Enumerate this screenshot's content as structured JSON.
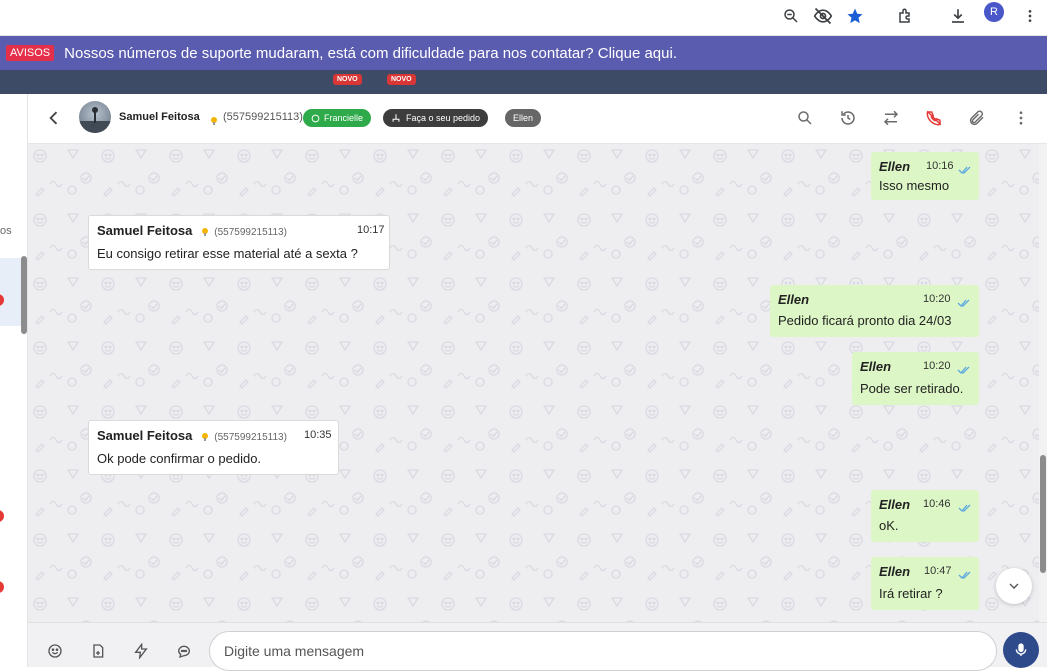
{
  "browser": {
    "profile_initial": "R",
    "icons": [
      "zoom-icon",
      "eye-off-icon",
      "star-icon",
      "extensions-icon",
      "download-icon",
      "menu-dots-icon"
    ]
  },
  "notice": {
    "badge": "AVISOS",
    "text": "Nossos números de suporte mudaram, está com dificuldade para nos contatar? Clique aqui."
  },
  "app_strip": {
    "new_badges": [
      "NOVO",
      "NOVO"
    ]
  },
  "sidebar_sliver": {
    "text_fragment": "os"
  },
  "chat_header": {
    "contact_name": "Samuel Feitosa",
    "contact_phone": "(557599215113)",
    "tags": [
      {
        "label": "Francielle",
        "color": "#2eaa4a"
      },
      {
        "label": "Faça o seu pedido",
        "color": "#3d3d3d"
      },
      {
        "label": "Ellen",
        "color": "#666666"
      }
    ]
  },
  "messages": [
    {
      "direction": "out",
      "sender": "Ellen",
      "time": "10:16",
      "text": "Isso mesmo"
    },
    {
      "direction": "in",
      "sender": "Samuel Feitosa",
      "phone": "(557599215113)",
      "time": "10:17",
      "text": "Eu consigo retirar esse material até a sexta ?"
    },
    {
      "direction": "out",
      "sender": "Ellen",
      "time": "10:20",
      "text": "Pedido ficará pronto dia 24/03"
    },
    {
      "direction": "out",
      "sender": "Ellen",
      "time": "10:20",
      "text": "Pode ser retirado."
    },
    {
      "direction": "in",
      "sender": "Samuel Feitosa",
      "phone": "(557599215113)",
      "time": "10:35",
      "text": "Ok pode confirmar o pedido."
    },
    {
      "direction": "out",
      "sender": "Ellen",
      "time": "10:46",
      "text": "oK."
    },
    {
      "direction": "out",
      "sender": "Ellen",
      "time": "10:47",
      "text": "Irá retirar ?"
    }
  ],
  "composer": {
    "placeholder": "Digite uma mensagem"
  },
  "colors": {
    "banner": "#5a5cb0",
    "outgoing_bubble": "#dcf7c5",
    "incoming_bubble": "#ffffff",
    "send_button": "#2e4a8a"
  }
}
